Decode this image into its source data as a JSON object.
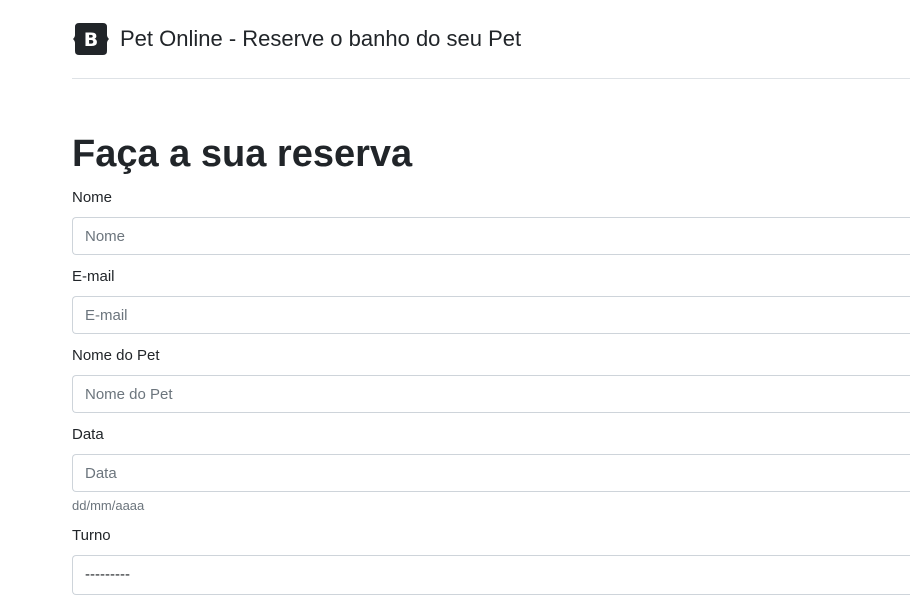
{
  "header": {
    "logo_letter": "B",
    "title": "Pet Online - Reserve o banho do seu Pet"
  },
  "page_title": "Faça a sua reserva",
  "form": {
    "nome": {
      "label": "Nome",
      "placeholder": "Nome",
      "value": ""
    },
    "email": {
      "label": "E-mail",
      "placeholder": "E-mail",
      "value": ""
    },
    "nome_pet": {
      "label": "Nome do Pet",
      "placeholder": "Nome do Pet",
      "value": ""
    },
    "data": {
      "label": "Data",
      "placeholder": "Data",
      "value": "",
      "help": "dd/mm/aaaa"
    },
    "turno": {
      "label": "Turno",
      "selected": "---------"
    }
  },
  "colors": {
    "logo_bg": "#212529",
    "border": "#ced4da",
    "divider": "#dee2e6",
    "placeholder": "#6c757d"
  }
}
